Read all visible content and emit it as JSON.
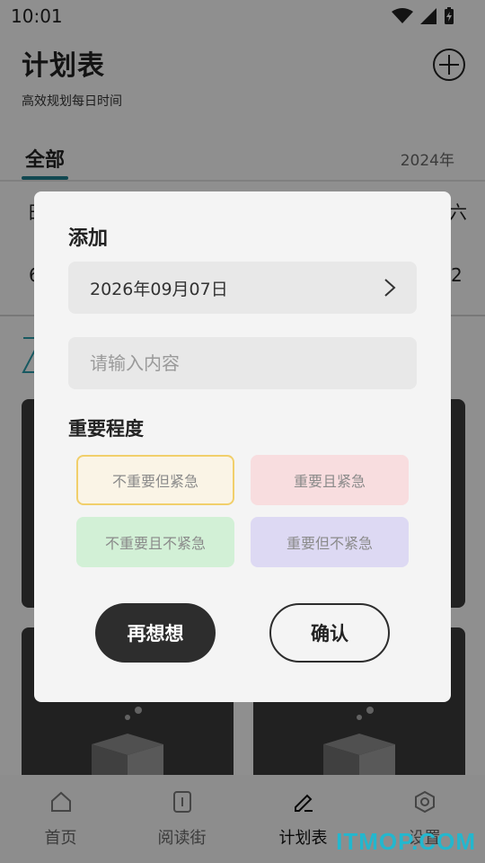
{
  "status_bar": {
    "time": "10:01"
  },
  "header": {
    "title": "计划表",
    "subtitle": "高效规划每日时间"
  },
  "tabs": {
    "active": "全部",
    "year": "2024年"
  },
  "calendar": {
    "week_start_partial": "日",
    "week_end_partial": "六",
    "date_start_partial": "6",
    "date_end_partial": "2"
  },
  "dialog": {
    "title": "添加",
    "date_value": "2026年09月07日",
    "input_placeholder": "请输入内容",
    "importance_heading": "重要程度",
    "options": [
      {
        "label": "不重要但紧急",
        "color": "#f1cf6b",
        "selected": true
      },
      {
        "label": "重要且紧急",
        "color": "#f8dddf"
      },
      {
        "label": "不重要且不紧急",
        "color": "#d2f0d6"
      },
      {
        "label": "重要但不紧急",
        "color": "#ddd9f3"
      }
    ],
    "cancel_label": "再想想",
    "confirm_label": "确认"
  },
  "nav": [
    {
      "label": "首页",
      "icon": "home-icon"
    },
    {
      "label": "阅读街",
      "icon": "book-icon"
    },
    {
      "label": "计划表",
      "icon": "pencil-icon",
      "active": true
    },
    {
      "label": "设置",
      "icon": "settings-icon"
    }
  ],
  "watermark": "ITMOP.COM",
  "colors": {
    "accent": "#1f7c8c"
  }
}
